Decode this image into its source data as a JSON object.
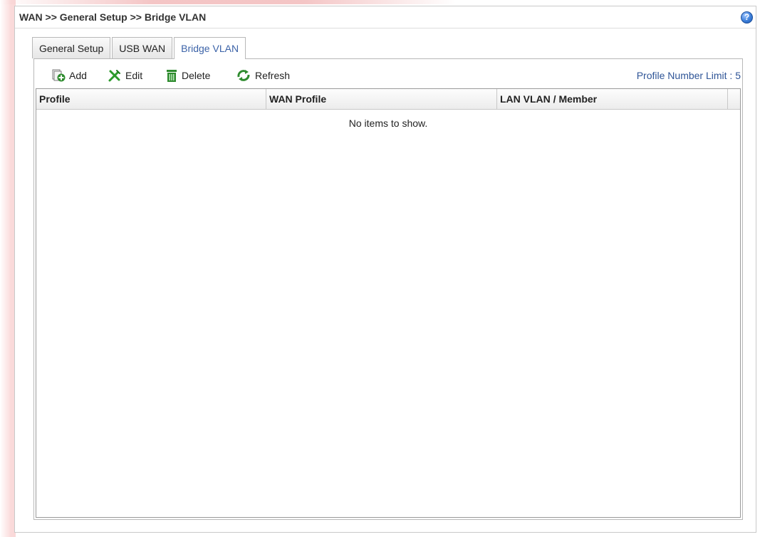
{
  "breadcrumb": "WAN >> General Setup >> Bridge VLAN",
  "tabs": [
    {
      "label": "General Setup",
      "active": false
    },
    {
      "label": "USB WAN",
      "active": false
    },
    {
      "label": "Bridge VLAN",
      "active": true
    }
  ],
  "toolbar": {
    "add_label": "Add",
    "edit_label": "Edit",
    "delete_label": "Delete",
    "refresh_label": "Refresh",
    "profile_limit": "Profile Number Limit : 5"
  },
  "table": {
    "columns": [
      "Profile",
      "WAN Profile",
      "LAN VLAN / Member"
    ],
    "rows": [],
    "empty_text": "No items to show."
  },
  "colors": {
    "accent": "#3c63a8",
    "add_icon": "#2e8b2e",
    "edit_icon": "#2a9a2a",
    "delete_icon": "#2e8b2e",
    "refresh_icon": "#2e8b2e"
  },
  "icons": {
    "help": "help-icon",
    "add": "add-icon",
    "edit": "edit-icon",
    "delete": "delete-icon",
    "refresh": "refresh-icon"
  }
}
